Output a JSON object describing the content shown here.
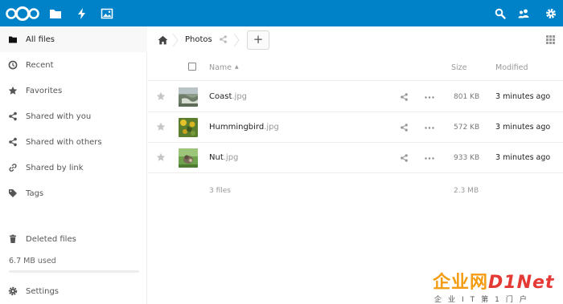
{
  "header": {
    "apps": [
      "files-icon",
      "activity-icon",
      "gallery-icon"
    ],
    "right_icons": [
      "search-icon",
      "contacts-icon",
      "settings-gear-icon"
    ],
    "colors": {
      "brand": "#0082c9"
    }
  },
  "sidebar": {
    "items": [
      {
        "label": "All files",
        "icon": "folder-icon",
        "active": true
      },
      {
        "label": "Recent",
        "icon": "clock-icon"
      },
      {
        "label": "Favorites",
        "icon": "star-icon"
      },
      {
        "label": "Shared with you",
        "icon": "share-icon"
      },
      {
        "label": "Shared with others",
        "icon": "share-icon"
      },
      {
        "label": "Shared by link",
        "icon": "link-icon"
      },
      {
        "label": "Tags",
        "icon": "tag-icon"
      }
    ],
    "deleted_files": "Deleted files",
    "quota_text": "6.7 MB used",
    "quota_fraction": 0.0,
    "settings": "Settings"
  },
  "breadcrumb": {
    "current": "Photos",
    "add_label": "+"
  },
  "table": {
    "columns": {
      "name": "Name",
      "size": "Size",
      "modified": "Modified"
    },
    "rows": [
      {
        "base": "Coast",
        "ext": ".jpg",
        "size": "801 KB",
        "modified": "3 minutes ago"
      },
      {
        "base": "Hummingbird",
        "ext": ".jpg",
        "size": "572 KB",
        "modified": "3 minutes ago"
      },
      {
        "base": "Nut",
        "ext": ".jpg",
        "size": "933 KB",
        "modified": "3 minutes ago"
      }
    ],
    "summary": {
      "files": "3 files",
      "size": "2.3 MB"
    }
  },
  "watermark": {
    "brand_cn": "企业网",
    "brand_en": "D1Net",
    "tagline": "企业IT第1门户"
  }
}
